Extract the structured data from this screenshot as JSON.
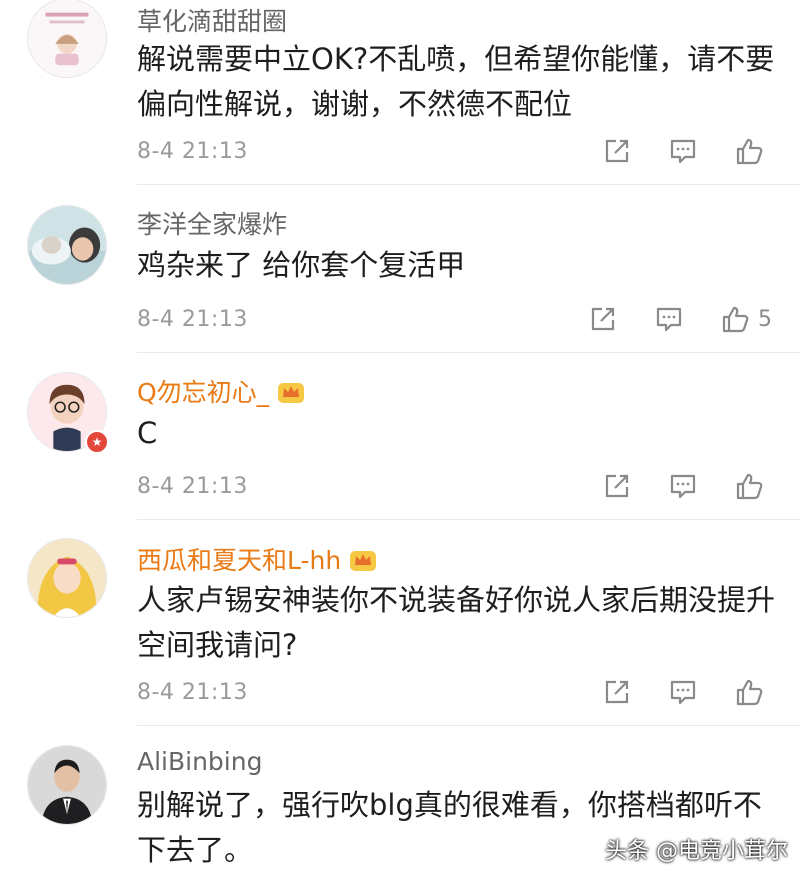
{
  "comments": [
    {
      "username": "草化滴甜甜圈",
      "vip": false,
      "text": "解说需要中立OK?不乱喷，但希望你能懂，请不要偏向性解说，谢谢，不然德不配位",
      "time": "8-4  21:13",
      "likes": ""
    },
    {
      "username": "李洋全家爆炸",
      "vip": false,
      "text": "鸡杂来了  给你套个复活甲",
      "time": "8-4  21:13",
      "likes": "5"
    },
    {
      "username": "Q勿忘初心_",
      "vip": true,
      "text": "C",
      "time": "8-4  21:13",
      "likes": ""
    },
    {
      "username": "西瓜和夏天和L-hh",
      "vip": true,
      "text": "人家卢锡安神装你不说装备好你说人家后期没提升空间我请问?",
      "time": "8-4  21:13",
      "likes": ""
    },
    {
      "username": "AliBinbing",
      "vip": false,
      "text": "别解说了，强行吹blg真的很难看，你搭档都听不下去了。",
      "time": "",
      "likes": ""
    }
  ],
  "watermark": "头条 @电竞小茸尔",
  "colors": {
    "vip_name": "#ea7a14",
    "normal_name": "#666666",
    "time": "#9a9a9a",
    "icon": "#8a8a8a"
  },
  "icons": [
    "share-icon",
    "comment-icon",
    "like-icon",
    "crown-icon",
    "verified-badge"
  ]
}
